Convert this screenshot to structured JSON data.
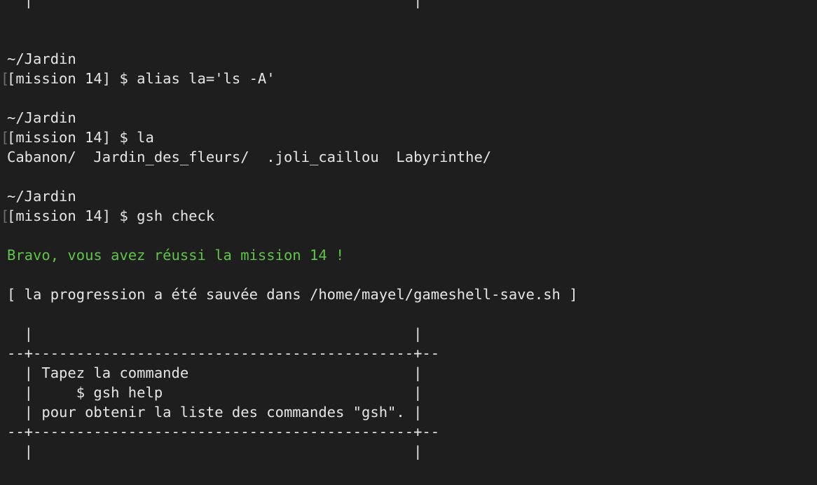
{
  "lines": [
    {
      "type": "out",
      "text": "  |                                            |"
    },
    {
      "type": "blank",
      "text": ""
    },
    {
      "type": "blank",
      "text": ""
    },
    {
      "type": "path",
      "text": "~/Jardin"
    },
    {
      "type": "prompt",
      "text": "[mission 14] $ alias la='ls -A'"
    },
    {
      "type": "blank",
      "text": ""
    },
    {
      "type": "path",
      "text": "~/Jardin"
    },
    {
      "type": "prompt",
      "text": "[mission 14] $ la"
    },
    {
      "type": "out",
      "text": "Cabanon/  Jardin_des_fleurs/  .joli_caillou  Labyrinthe/"
    },
    {
      "type": "blank",
      "text": ""
    },
    {
      "type": "path",
      "text": "~/Jardin"
    },
    {
      "type": "prompt",
      "text": "[mission 14] $ gsh check"
    },
    {
      "type": "blank",
      "text": ""
    },
    {
      "type": "success",
      "text": "Bravo, vous avez réussi la mission 14 !"
    },
    {
      "type": "blank",
      "text": ""
    },
    {
      "type": "out",
      "text": "[ la progression a été sauvée dans /home/mayel/gameshell-save.sh ]"
    },
    {
      "type": "blank",
      "text": ""
    },
    {
      "type": "out",
      "text": "  |                                            |"
    },
    {
      "type": "out",
      "text": "--+--------------------------------------------+--"
    },
    {
      "type": "out",
      "text": "  | Tapez la commande                          |"
    },
    {
      "type": "out",
      "text": "  |     $ gsh help                             |"
    },
    {
      "type": "out",
      "text": "  | pour obtenir la liste des commandes \"gsh\". |"
    },
    {
      "type": "out",
      "text": "--+--------------------------------------------+--"
    },
    {
      "type": "out",
      "text": "  |                                            |"
    }
  ],
  "colors": {
    "background": "#1e1e1e",
    "text": "#e6e6e6",
    "success": "#5fc548",
    "prompt_mark": "#6d6d6d"
  },
  "icons": {
    "prompt_mark": "[",
    "prompt_mark_name": "prompt-mark-icon"
  }
}
